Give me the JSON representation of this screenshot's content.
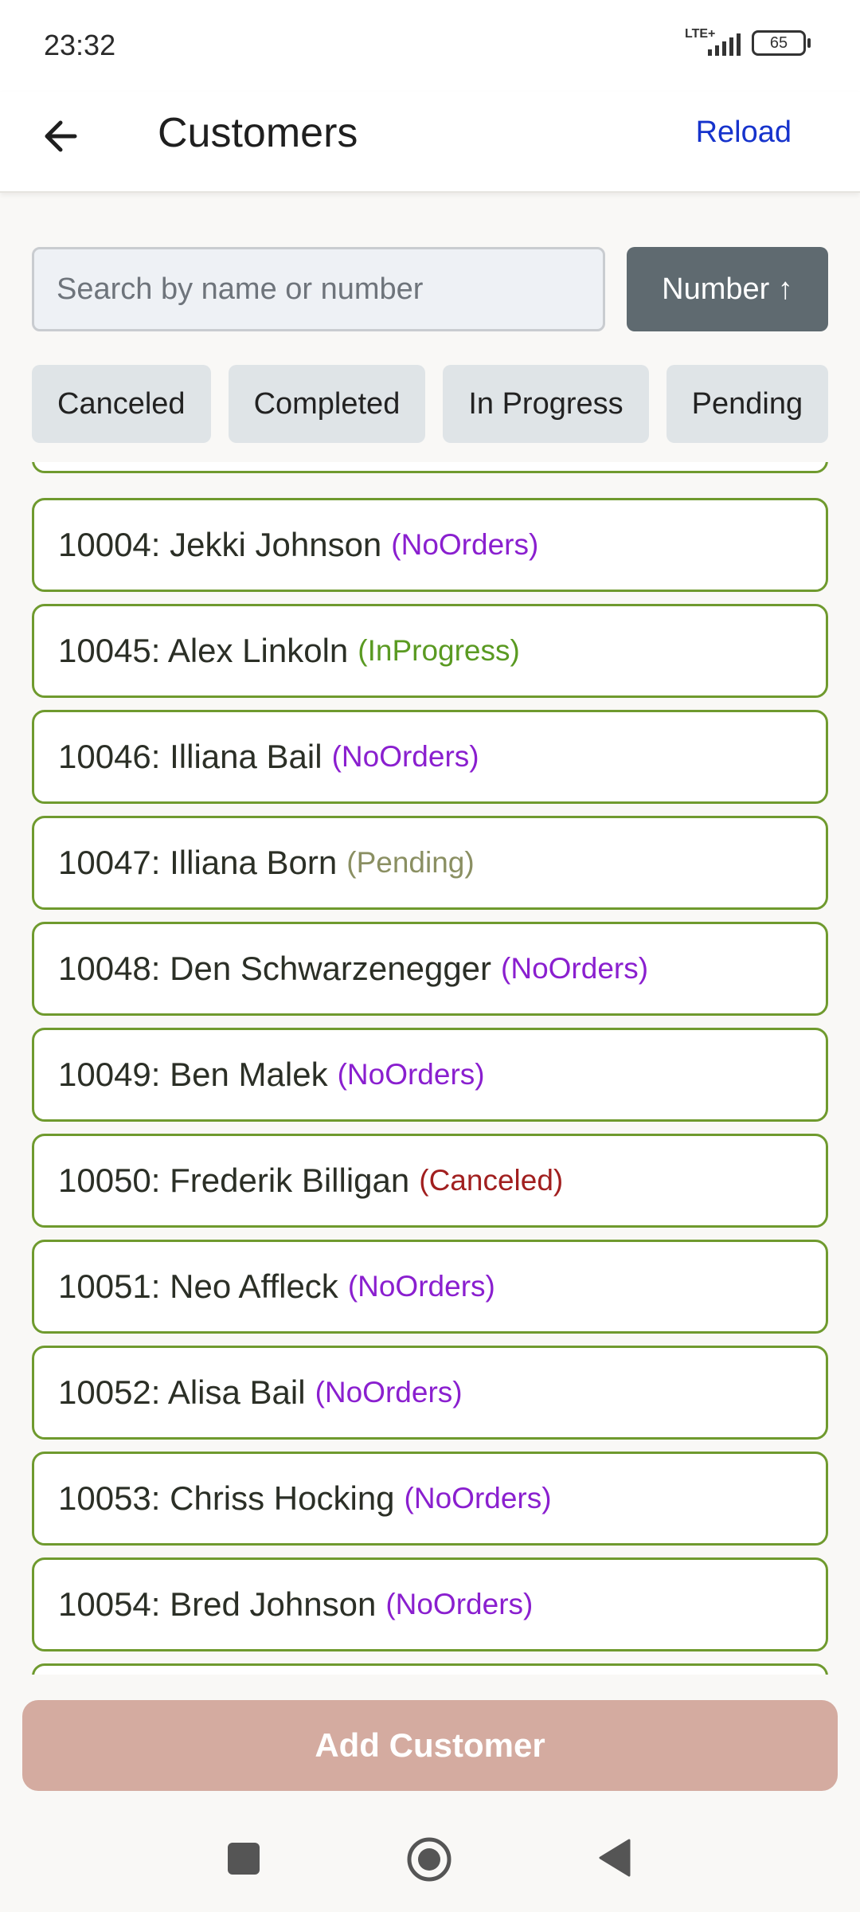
{
  "status_bar": {
    "time": "23:32",
    "network": "LTE+",
    "battery": "65"
  },
  "app_bar": {
    "title": "Customers",
    "reload_label": "Reload"
  },
  "search": {
    "placeholder": "Search by name or number",
    "value": ""
  },
  "sort_button": {
    "label": "Number ↑"
  },
  "filters": [
    "Canceled",
    "Completed",
    "In Progress",
    "Pending"
  ],
  "status_colors": {
    "NoOrders": "#8a1fcf",
    "InProgress": "#5a9a22",
    "Pending": "#8a8f62",
    "Canceled": "#a11f1f"
  },
  "customers": [
    {
      "label": "10004: Jekki Johnson",
      "status": "(NoOrders)",
      "status_key": "NoOrders"
    },
    {
      "label": "10045: Alex Linkoln",
      "status": "(InProgress)",
      "status_key": "InProgress"
    },
    {
      "label": "10046: Illiana Bail",
      "status": "(NoOrders)",
      "status_key": "NoOrders"
    },
    {
      "label": "10047: Illiana Born",
      "status": "(Pending)",
      "status_key": "Pending"
    },
    {
      "label": "10048: Den Schwarzenegger",
      "status": "(NoOrders)",
      "status_key": "NoOrders"
    },
    {
      "label": "10049: Ben Malek",
      "status": "(NoOrders)",
      "status_key": "NoOrders"
    },
    {
      "label": "10050: Frederik Billigan",
      "status": "(Canceled)",
      "status_key": "Canceled"
    },
    {
      "label": "10051: Neo Affleck",
      "status": "(NoOrders)",
      "status_key": "NoOrders"
    },
    {
      "label": "10052: Alisa Bail",
      "status": "(NoOrders)",
      "status_key": "NoOrders"
    },
    {
      "label": "10053: Chriss Hocking",
      "status": "(NoOrders)",
      "status_key": "NoOrders"
    },
    {
      "label": "10054: Bred Johnson",
      "status": "(NoOrders)",
      "status_key": "NoOrders"
    }
  ],
  "add_button": {
    "label": "Add Customer"
  },
  "nav": {
    "recents_icon": "square-icon",
    "home_icon": "circle-icon",
    "back_icon": "triangle-back-icon"
  }
}
